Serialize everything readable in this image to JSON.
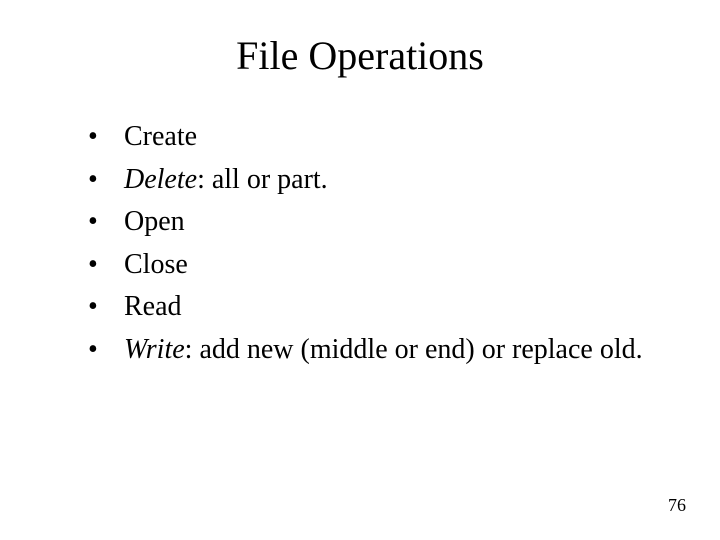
{
  "title": "File Operations",
  "bullets": {
    "b0": {
      "text": "Create"
    },
    "b1": {
      "em": "Delete",
      "rest": ": all or part."
    },
    "b2": {
      "text": "Open"
    },
    "b3": {
      "text": "Close"
    },
    "b4": {
      "text": "Read"
    },
    "b5": {
      "em": "Write",
      "rest": ": add new (middle or end) or replace old."
    }
  },
  "page_number": "76",
  "dot": "•"
}
